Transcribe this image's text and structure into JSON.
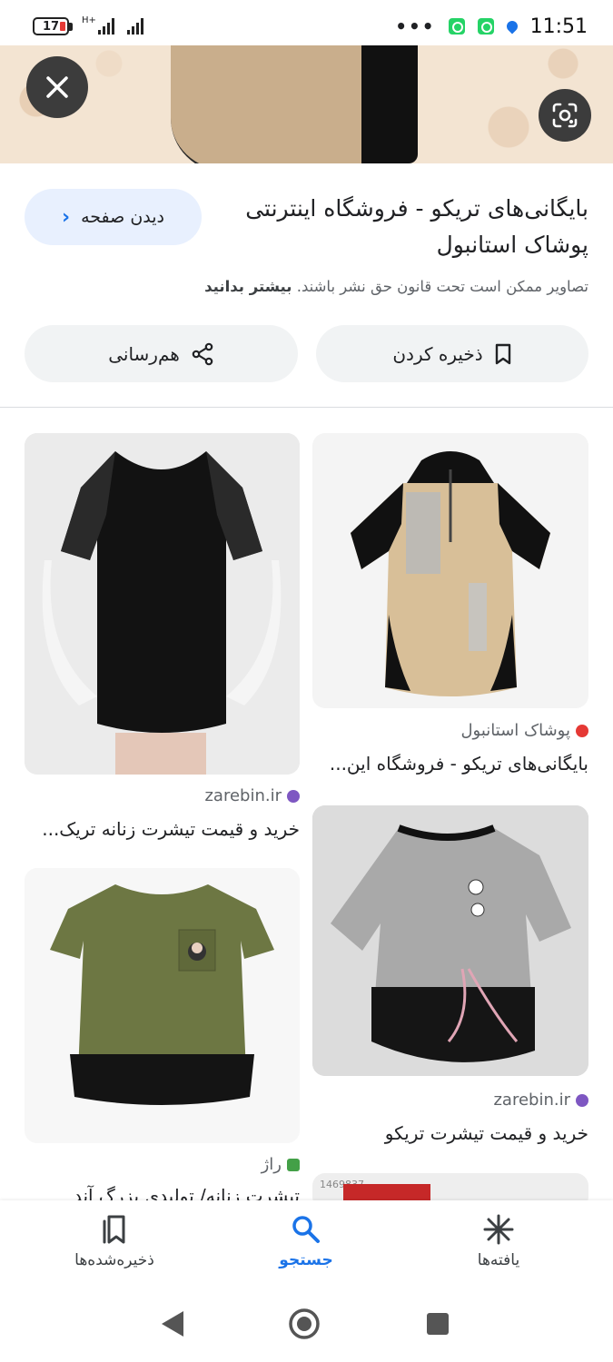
{
  "status": {
    "battery": "17",
    "network": "H+",
    "overflow": "•••",
    "time": "11:51"
  },
  "hero": {
    "close_icon": "close-icon",
    "lens_icon": "google-lens-icon"
  },
  "detail": {
    "title": "بایگانی‌های تریکو - فروشگاه اینترنتی پوشاک استانبول",
    "visit_label": "دیدن صفحه",
    "copyright_text": "تصاویر ممکن است تحت قانون حق نشر باشند.",
    "learn_more": "بیشتر بدانید",
    "save_label": "ذخیره کردن",
    "share_label": "هم‌رسانی"
  },
  "results": [
    {
      "source": "پوشاک استانبول",
      "caption": "بایگانی‌های تریکو - فروشگاه این...",
      "source_color": "#e53935"
    },
    {
      "source": "zarebin.ir",
      "caption": "خرید و قیمت تیشرت زنانه تریک...",
      "source_color": "#7e57c2"
    },
    {
      "source": "zarebin.ir",
      "caption": "خرید و قیمت تیشرت تریکو",
      "source_color": "#7e57c2"
    },
    {
      "source": "راژ",
      "caption": "تیشرت زنانه/ تولیدی بزرگ آند",
      "source_color": "#43a047"
    },
    {
      "source": "",
      "caption": "",
      "watermark": "1469837"
    }
  ],
  "bottom_nav": {
    "items": [
      {
        "label": "یافته‌ها",
        "icon": "asterisk-icon"
      },
      {
        "label": "جستجو",
        "icon": "search-icon"
      },
      {
        "label": "ذخیره‌شده‌ها",
        "icon": "bookmarks-icon"
      }
    ],
    "active": "جستجو"
  },
  "colors": {
    "accent": "#1a73e8",
    "chip_bg": "#f1f3f4",
    "visit_bg": "#e8f0fe"
  }
}
